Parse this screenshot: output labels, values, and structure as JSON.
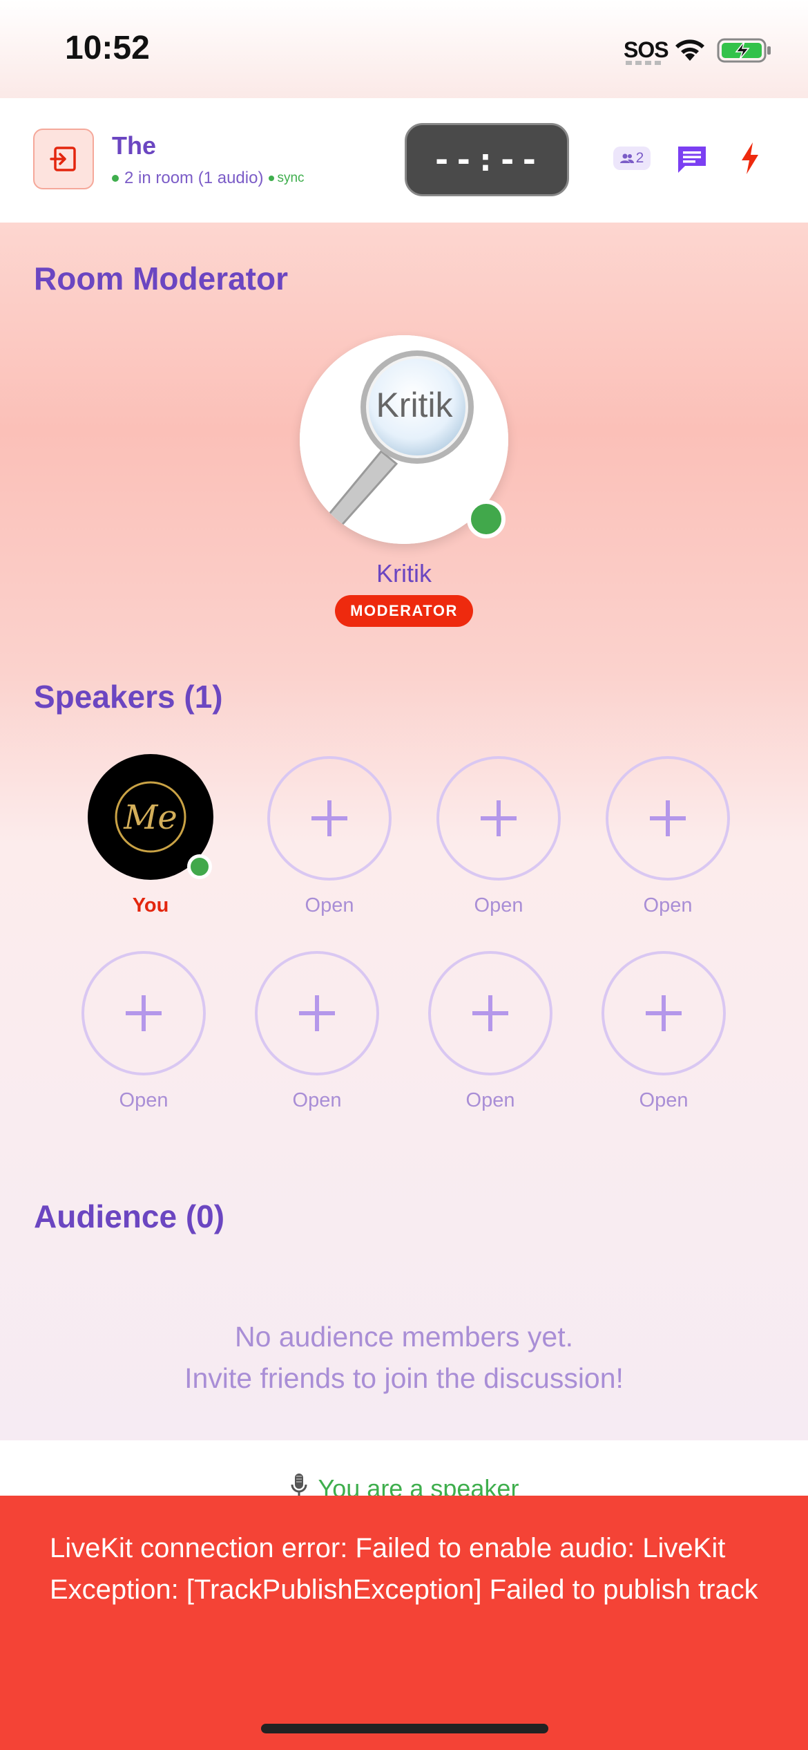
{
  "status_bar": {
    "time": "10:52",
    "sos": "SOS"
  },
  "header": {
    "room_title": "The",
    "room_status": "2 in room (1 audio)",
    "sync_label": "sync",
    "timer": "--:--",
    "participant_count": "2",
    "icons": [
      "leave-icon",
      "people-icon",
      "chat-icon",
      "bolt-icon"
    ],
    "colors": {
      "accent": "#6b46c1",
      "live": "#3fae4d",
      "alert": "#ee2a0e"
    }
  },
  "moderator_section": {
    "title": "Room Moderator",
    "moderator": {
      "name": "Kritik",
      "avatar_text": "Kritik",
      "badge": "MODERATOR",
      "online": true
    }
  },
  "speakers_section": {
    "title": "Speakers (1)",
    "self": {
      "label": "You",
      "avatar_text": "Me",
      "online": true
    },
    "open_seats": [
      {
        "label": "Open"
      },
      {
        "label": "Open"
      },
      {
        "label": "Open"
      },
      {
        "label": "Open"
      },
      {
        "label": "Open"
      },
      {
        "label": "Open"
      },
      {
        "label": "Open"
      }
    ]
  },
  "audience_section": {
    "title": "Audience (0)",
    "empty_line1": "No audience members yet.",
    "empty_line2": "Invite friends to join the discussion!"
  },
  "speaker_strip": {
    "text": "You are a speaker"
  },
  "error_snackbar": {
    "message": "LiveKit connection error: Failed to enable audio: LiveKit Exception: [TrackPublishException] Failed to publish track",
    "color": "#f44336"
  }
}
